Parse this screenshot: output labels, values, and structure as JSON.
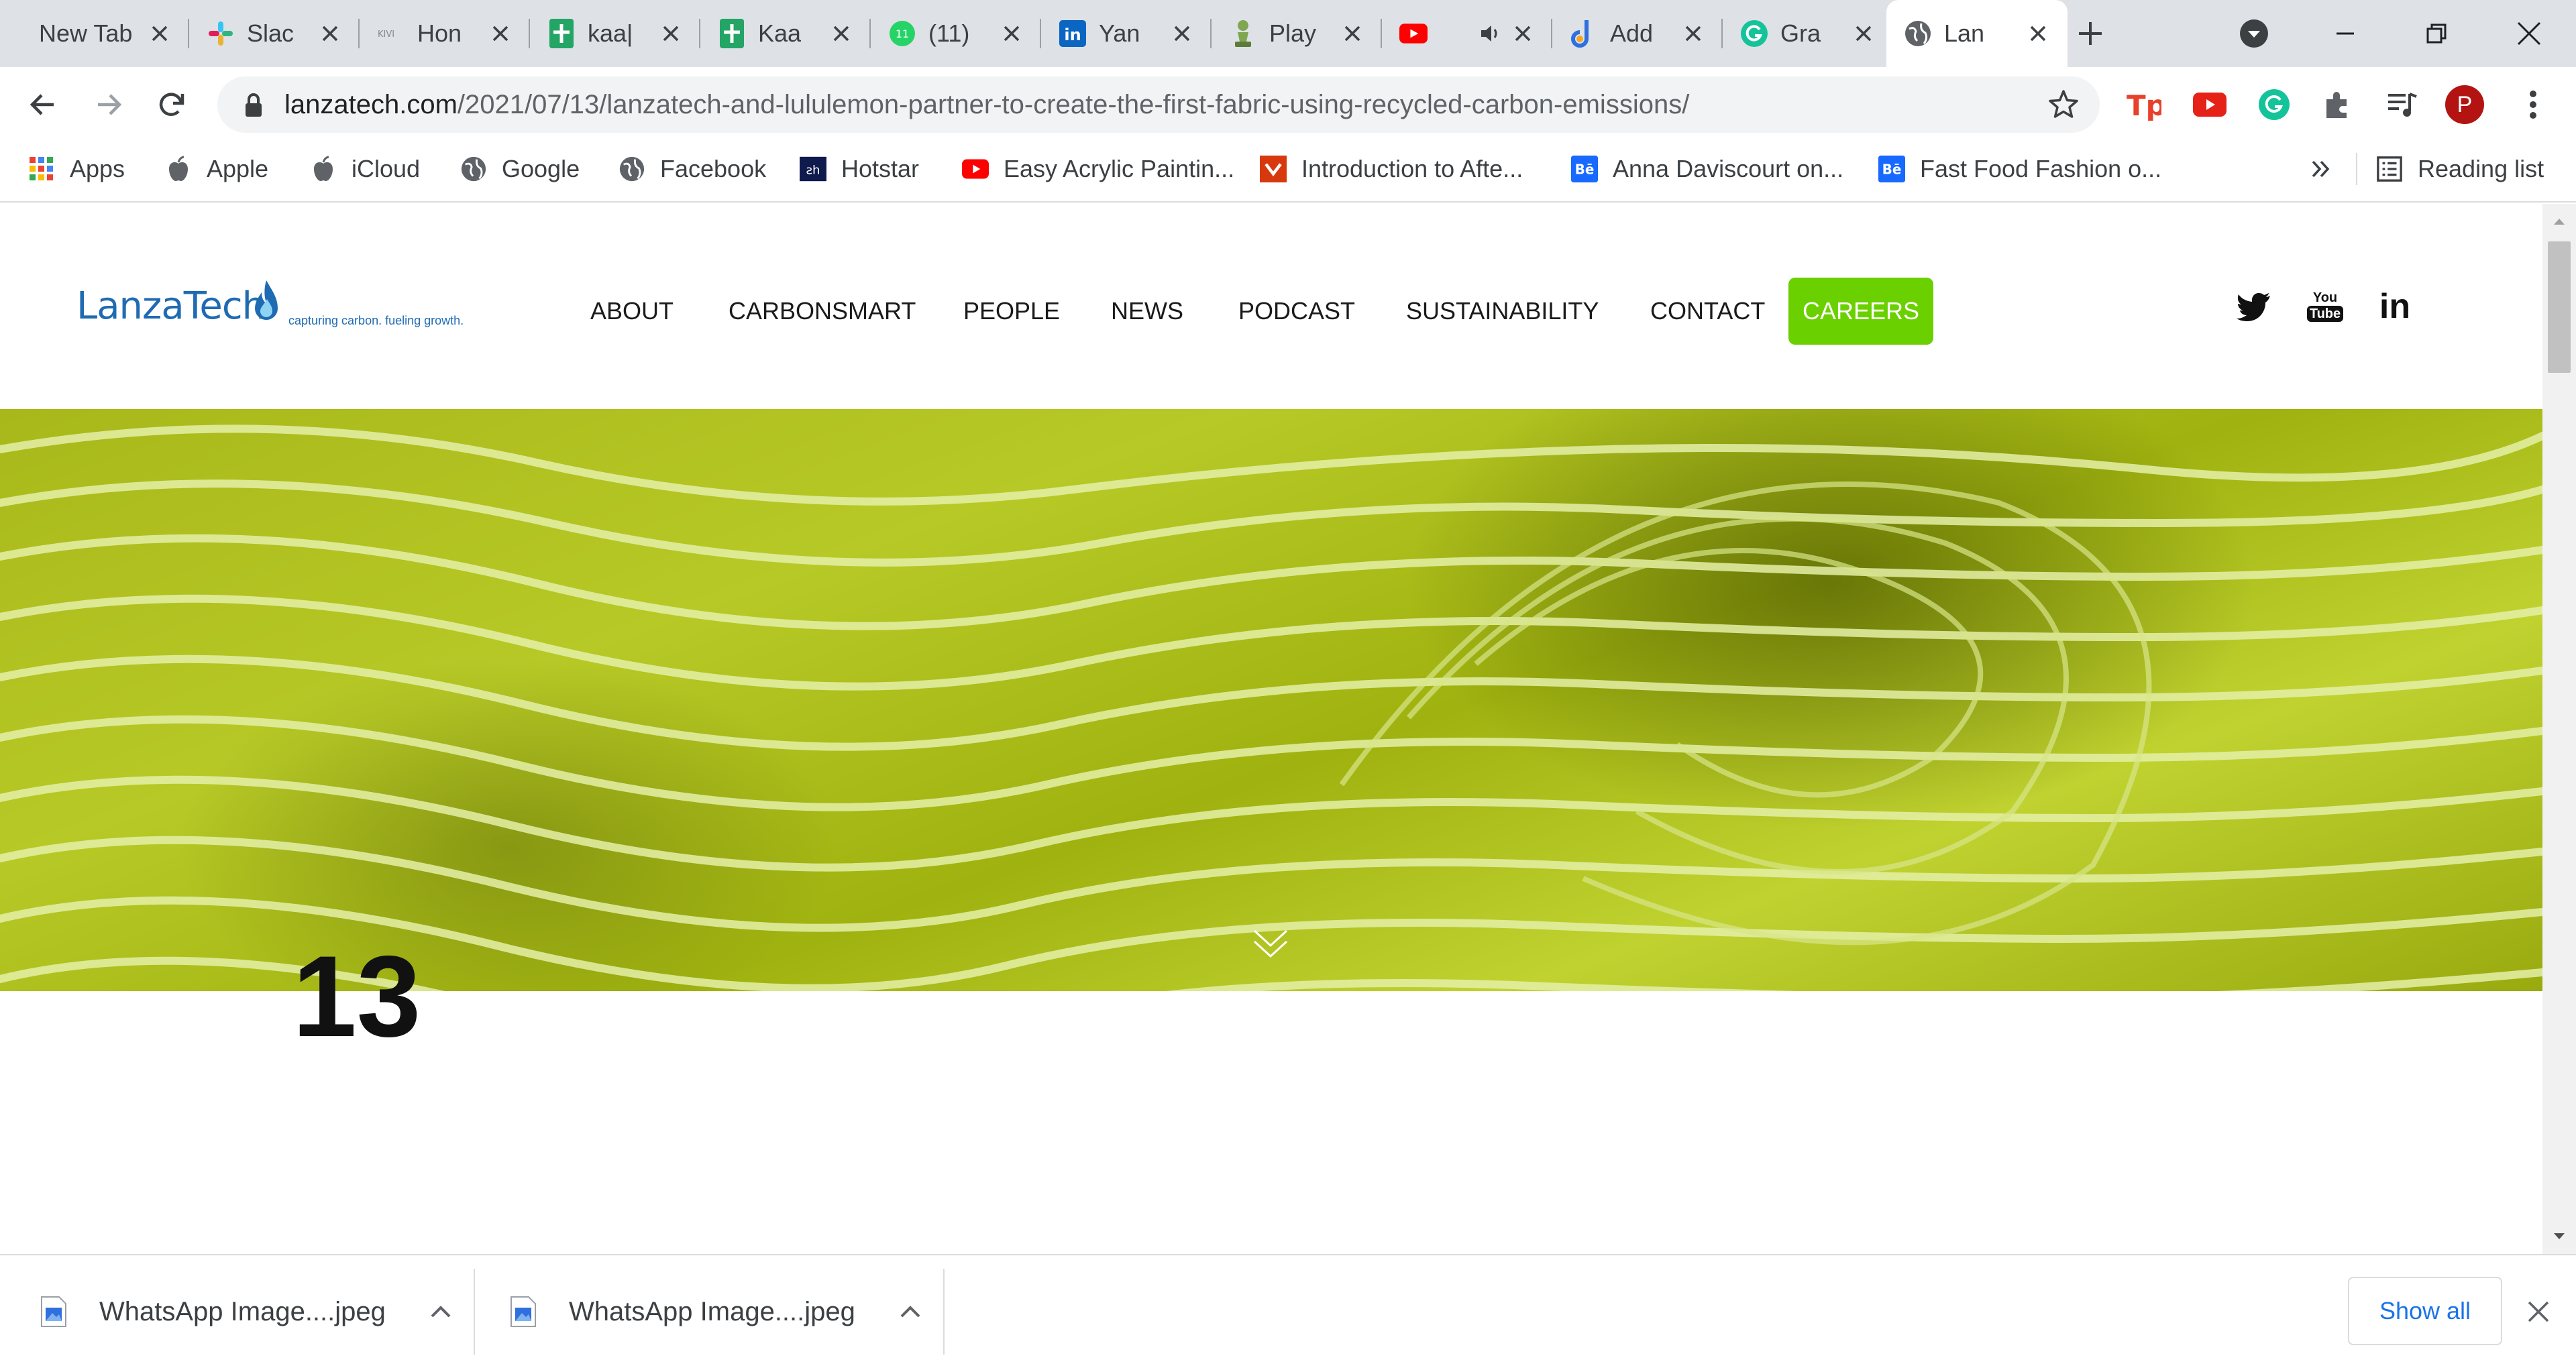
{
  "tabs": [
    {
      "title": "New Tab",
      "icon": "none"
    },
    {
      "title": "Slac",
      "icon": "slack-icon"
    },
    {
      "title": "Hon",
      "icon": "kivi-icon"
    },
    {
      "title": "kaa|",
      "icon": "sheets-icon"
    },
    {
      "title": "Kaa",
      "icon": "sheets-icon"
    },
    {
      "title": "(11)",
      "icon": "whatsapp-icon",
      "badge": "11"
    },
    {
      "title": "Yan",
      "icon": "linkedin-icon"
    },
    {
      "title": "Play",
      "icon": "chess-icon"
    },
    {
      "title": "",
      "icon": "youtube-icon",
      "audio": "speaker-icon"
    },
    {
      "title": "Add",
      "icon": "d-logo-icon"
    },
    {
      "title": "Gra",
      "icon": "grammarly-icon"
    },
    {
      "title": "Lan",
      "icon": "globe-icon",
      "active": true
    }
  ],
  "toolbar": {
    "url_host": "lanzatech.com",
    "url_path": "/2021/07/13/lanzatech-and-lululemon-partner-to-create-the-first-fabric-using-recycled-carbon-emissions/",
    "profile_initial": "P"
  },
  "bookmarks": [
    {
      "label": "Apps",
      "icon": "apps-grid-icon"
    },
    {
      "label": "Apple",
      "icon": "apple-icon"
    },
    {
      "label": "iCloud",
      "icon": "apple-icon"
    },
    {
      "label": "Google",
      "icon": "globe-icon"
    },
    {
      "label": "Facebook",
      "icon": "globe-icon"
    },
    {
      "label": "Hotstar",
      "icon": "hotstar-icon"
    },
    {
      "label": "Easy Acrylic Paintin...",
      "icon": "youtube-icon"
    },
    {
      "label": "Introduction to Afte...",
      "icon": "udemy-icon"
    },
    {
      "label": "Anna Daviscourt on...",
      "icon": "behance-icon"
    },
    {
      "label": "Fast Food Fashion o...",
      "icon": "behance-icon"
    }
  ],
  "reading_list": "Reading list",
  "site": {
    "logo_name": "LanzaTech",
    "logo_tagline": "capturing carbon. fueling growth.",
    "nav": [
      "ABOUT",
      "CARBONSMART",
      "PEOPLE",
      "NEWS",
      "PODCAST",
      "SUSTAINABILITY",
      "CONTACT",
      "CAREERS"
    ],
    "social": [
      "twitter-icon",
      "youtube-icon",
      "linkedin-icon"
    ],
    "youtube_text_top": "You",
    "youtube_text_bottom": "Tube",
    "linkedin_text": "in",
    "date_day": "13"
  },
  "downloads": [
    {
      "name": "WhatsApp Image....jpeg"
    },
    {
      "name": "WhatsApp Image....jpeg"
    }
  ],
  "show_all_label": "Show all",
  "colors": {
    "careers_green": "#6ad000",
    "brand_blue": "#1f6bb3",
    "link_blue": "#1a73e8"
  }
}
